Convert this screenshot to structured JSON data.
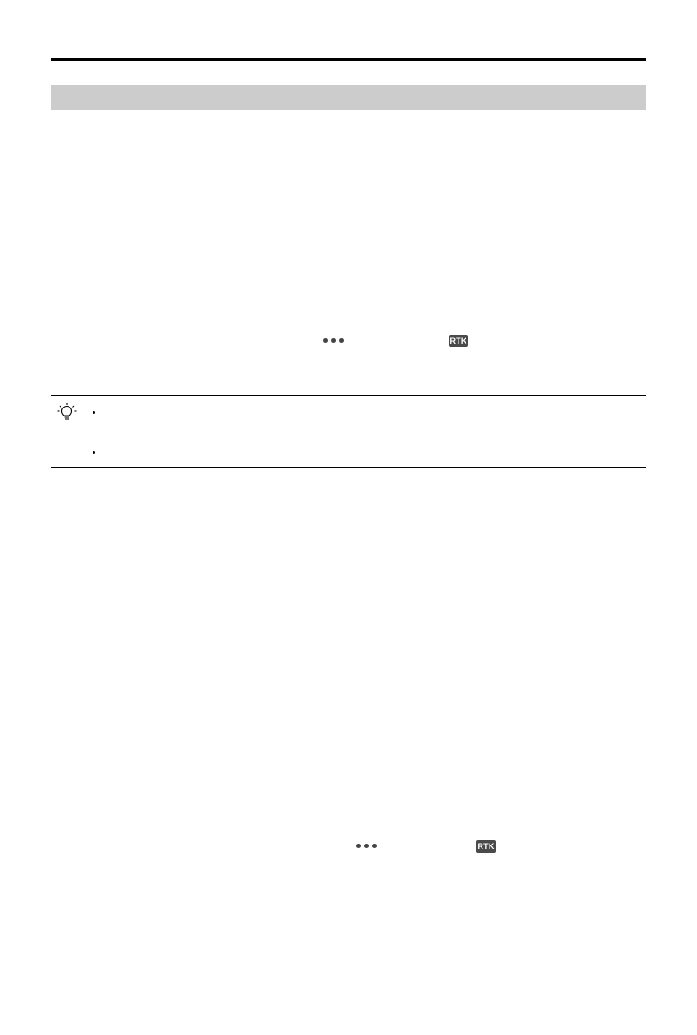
{
  "page": {
    "header_rule": true,
    "section_bar": {
      "title": ""
    },
    "icons": {
      "more": "more-dots-icon",
      "rtk": "RTK",
      "tip": "lightbulb-tip-icon"
    },
    "tip": {
      "bullets": [
        "",
        ""
      ]
    },
    "colors": {
      "section_bar": "#cccccc",
      "badge": "#4a4a4a"
    }
  }
}
